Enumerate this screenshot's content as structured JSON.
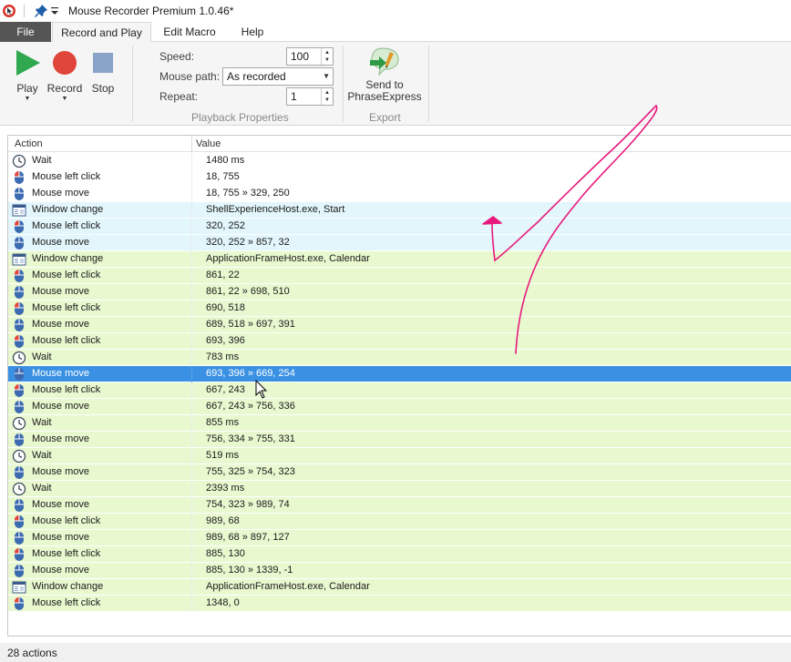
{
  "window": {
    "title": "Mouse Recorder Premium 1.0.46*"
  },
  "tabs": [
    {
      "label": "File"
    },
    {
      "label": "Record and Play"
    },
    {
      "label": "Edit Macro"
    },
    {
      "label": "Help"
    }
  ],
  "ribbon": {
    "play_label": "Play",
    "record_label": "Record",
    "stop_label": "Stop",
    "speed_label": "Speed:",
    "speed_value": "100",
    "mouse_path_label": "Mouse path:",
    "mouse_path_value": "As recorded",
    "repeat_label": "Repeat:",
    "repeat_value": "1",
    "playback_group_caption": "Playback Properties",
    "send_label_line1": "Send to",
    "send_label_line2": "PhraseExpress",
    "export_group_caption": "Export"
  },
  "grid": {
    "col_action": "Action",
    "col_value": "Value",
    "rows": [
      {
        "action": "Wait",
        "value": "1480 ms",
        "icon": "clock-icon",
        "tint": "none"
      },
      {
        "action": "Mouse left click",
        "value": "18, 755",
        "icon": "mouse-left-click-icon",
        "tint": "none"
      },
      {
        "action": "Mouse move",
        "value": "18, 755 » 329, 250",
        "icon": "mouse-icon",
        "tint": "none"
      },
      {
        "action": "Window change",
        "value": "ShellExperienceHost.exe, Start",
        "icon": "window-icon",
        "tint": "cyan"
      },
      {
        "action": "Mouse left click",
        "value": "320, 252",
        "icon": "mouse-left-click-icon",
        "tint": "cyan"
      },
      {
        "action": "Mouse move",
        "value": "320, 252 » 857, 32",
        "icon": "mouse-icon",
        "tint": "cyan"
      },
      {
        "action": "Window change",
        "value": "ApplicationFrameHost.exe, Calendar",
        "icon": "window-icon",
        "tint": "green"
      },
      {
        "action": "Mouse left click",
        "value": "861, 22",
        "icon": "mouse-left-click-icon",
        "tint": "green"
      },
      {
        "action": "Mouse move",
        "value": "861, 22 » 698, 510",
        "icon": "mouse-icon",
        "tint": "green"
      },
      {
        "action": "Mouse left click",
        "value": "690, 518",
        "icon": "mouse-left-click-icon",
        "tint": "green"
      },
      {
        "action": "Mouse move",
        "value": "689, 518 » 697, 391",
        "icon": "mouse-icon",
        "tint": "green"
      },
      {
        "action": "Mouse left click",
        "value": "693, 396",
        "icon": "mouse-left-click-icon",
        "tint": "green"
      },
      {
        "action": "Wait",
        "value": "783 ms",
        "icon": "clock-icon",
        "tint": "green"
      },
      {
        "action": "Mouse move",
        "value": "693, 396 » 669, 254",
        "icon": "mouse-icon",
        "tint": "selected"
      },
      {
        "action": "Mouse left click",
        "value": "667, 243",
        "icon": "mouse-left-click-icon",
        "tint": "green"
      },
      {
        "action": "Mouse move",
        "value": "667, 243 » 756, 336",
        "icon": "mouse-icon",
        "tint": "green"
      },
      {
        "action": "Wait",
        "value": "855 ms",
        "icon": "clock-icon",
        "tint": "green"
      },
      {
        "action": "Mouse move",
        "value": "756, 334 » 755, 331",
        "icon": "mouse-icon",
        "tint": "green"
      },
      {
        "action": "Wait",
        "value": "519 ms",
        "icon": "clock-icon",
        "tint": "green"
      },
      {
        "action": "Mouse move",
        "value": "755, 325 » 754, 323",
        "icon": "mouse-icon",
        "tint": "green"
      },
      {
        "action": "Wait",
        "value": "2393 ms",
        "icon": "clock-icon",
        "tint": "green"
      },
      {
        "action": "Mouse move",
        "value": "754, 323 » 989, 74",
        "icon": "mouse-icon",
        "tint": "green"
      },
      {
        "action": "Mouse left click",
        "value": "989, 68",
        "icon": "mouse-left-click-icon",
        "tint": "green"
      },
      {
        "action": "Mouse move",
        "value": "989, 68 » 897, 127",
        "icon": "mouse-icon",
        "tint": "green"
      },
      {
        "action": "Mouse left click",
        "value": "885, 130",
        "icon": "mouse-left-click-icon",
        "tint": "green"
      },
      {
        "action": "Mouse move",
        "value": "885, 130 » 1339, -1",
        "icon": "mouse-icon",
        "tint": "green"
      },
      {
        "action": "Window change",
        "value": "ApplicationFrameHost.exe, Calendar",
        "icon": "window-icon",
        "tint": "green"
      },
      {
        "action": "Mouse left click",
        "value": "1348, 0",
        "icon": "mouse-left-click-icon",
        "tint": "green"
      }
    ]
  },
  "status": {
    "text": "28 actions"
  },
  "colors": {
    "selection": "#3a91e3",
    "cyan_tint": "#e2f6fb",
    "green_tint": "#e8f8cf",
    "annotation_stroke": "#e8197d",
    "play_green": "#2fa84f",
    "record_red": "#e0453a",
    "stop_blue": "#8aa3c9"
  }
}
